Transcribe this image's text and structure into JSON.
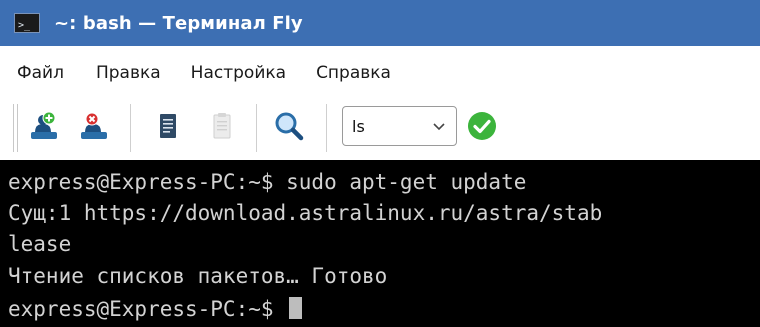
{
  "window": {
    "title": "~: bash — Терминал Fly",
    "app_icon_glyph": ">_",
    "app_icon_name": "terminal-app-icon"
  },
  "menu": {
    "items": [
      "Файл",
      "Правка",
      "Настройка",
      "Справка"
    ]
  },
  "toolbar": {
    "buttons": [
      {
        "icon": "add-user-icon"
      },
      {
        "icon": "remove-user-icon"
      },
      {
        "icon": "copy-icon"
      },
      {
        "icon": "paste-icon"
      },
      {
        "icon": "search-icon"
      }
    ],
    "command_combo": {
      "value": "ls",
      "icon": "chevron-down-icon"
    },
    "run_button": {
      "icon": "checkmark-icon"
    }
  },
  "terminal": {
    "lines": [
      "express@Express-PC:~$ sudo apt-get update",
      "Сущ:1 https://download.astralinux.ru/astra/stab",
      "lease",
      "Чтение списков пакетов… Готово",
      "express@Express-PC:~$"
    ]
  },
  "colors": {
    "titlebar": "#3d6fb3",
    "terminal_bg": "#000000",
    "terminal_fg": "#d3d3d3",
    "toolbar_icon_blue": "#2a6ea8",
    "check_green": "#3cb43c"
  }
}
